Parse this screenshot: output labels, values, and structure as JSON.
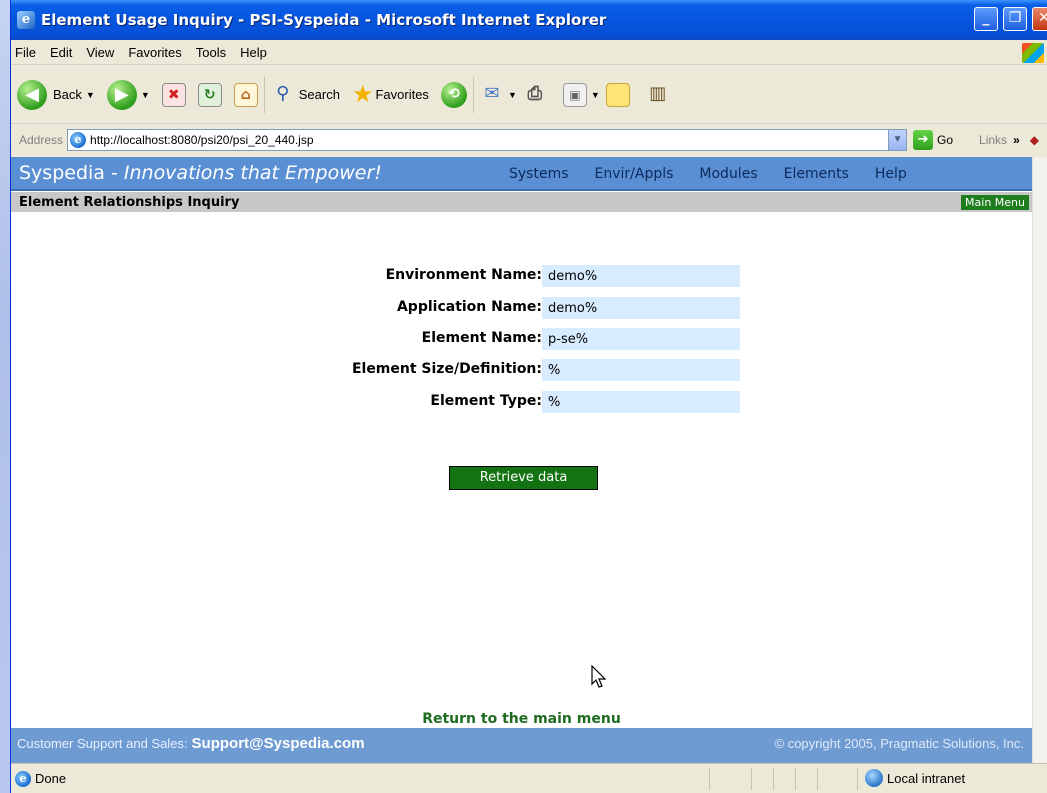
{
  "window": {
    "title": "Element Usage Inquiry - PSI-Syspeida - Microsoft Internet Explorer",
    "minimize_glyph": "_",
    "maximize_glyph": "❐",
    "close_glyph": "✕"
  },
  "menubar": {
    "items": [
      "File",
      "Edit",
      "View",
      "Favorites",
      "Tools",
      "Help"
    ]
  },
  "toolbar": {
    "back_label": "Back",
    "search_label": "Search",
    "favorites_label": "Favorites"
  },
  "addressbar": {
    "label": "Address",
    "url": "http://localhost:8080/psi20/psi_20_440.jsp",
    "go_label": "Go",
    "links_label": "Links"
  },
  "page": {
    "brand_name": "Syspedia",
    "brand_sep": " - ",
    "brand_tagline": "Innovations that Empower!",
    "nav": [
      "Systems",
      "Envir/Appls",
      "Modules",
      "Elements",
      "Help"
    ],
    "page_title": "Element Relationships Inquiry",
    "main_menu_label": "Main Menu",
    "form": {
      "environment_label": "Environment Name:",
      "environment_value": "demo%",
      "application_label": "Application Name:",
      "application_value": "demo%",
      "element_label": "Element Name:",
      "element_value": "p-se%",
      "size_label": "Element Size/Definition:",
      "size_value": "%",
      "type_label": "Element Type:",
      "type_value": "%"
    },
    "retrieve_label": "Retrieve data",
    "return_label": "Return to the main menu",
    "footer_support_label": "Customer Support and Sales:",
    "footer_email": "Support@Syspedia.com",
    "footer_copyright": "© copyright 2005, Pragmatic Solutions, Inc."
  },
  "statusbar": {
    "status": "Done",
    "zone": "Local intranet"
  }
}
